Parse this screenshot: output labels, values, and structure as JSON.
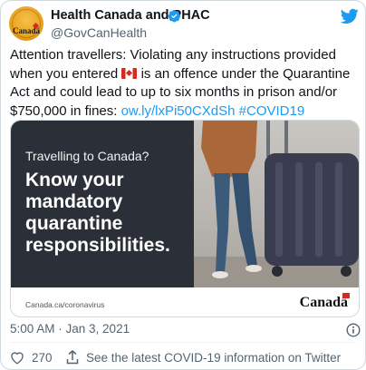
{
  "author": {
    "display_name": "Health Canada and PHAC",
    "handle": "@GovCanHealth",
    "avatar_text": "Canadä",
    "verified": true
  },
  "tweet": {
    "text_before_flag": "Attention travellers: Violating any instructions provided when you entered ",
    "flag_emoji": "🇨🇦",
    "text_after_flag": " is an offence under the Quarantine Act and could lead to up to six months in prison and/or $750,000 in fines: ",
    "link": "ow.ly/lxPi50CXdSh",
    "hashtag": "#COVID19"
  },
  "media": {
    "eyebrow": "Travelling to Canada?",
    "headline": "Know your mandatory quarantine responsibilities.",
    "url": "Canada.ca/coronavirus",
    "wordmark": "Canadä"
  },
  "meta": {
    "timestamp": "5:00 AM · Jan 3, 2021"
  },
  "actions": {
    "like_count": "270",
    "info_link": "See the latest COVID-19 information on Twitter"
  },
  "colors": {
    "accent": "#1d9bf0",
    "secondary_text": "#536471",
    "panel": "#2b3038",
    "canada_red": "#d52b1e"
  },
  "icons": [
    "verified-badge-icon",
    "twitter-bird-icon",
    "info-icon",
    "heart-icon",
    "share-icon",
    "canada-flag-icon"
  ]
}
